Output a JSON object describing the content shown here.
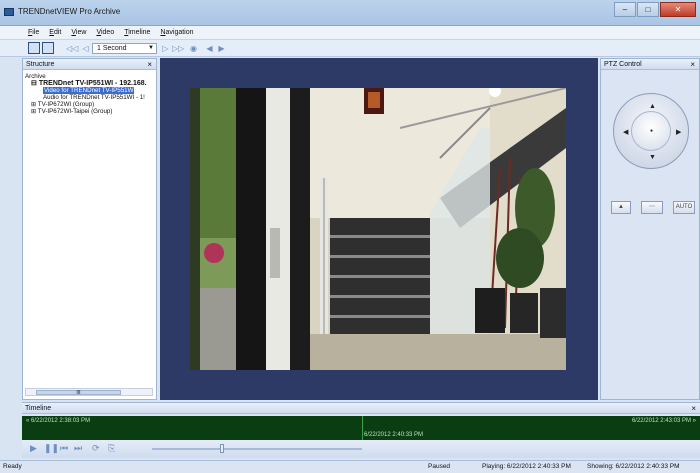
{
  "window": {
    "title": "TRENDnetVIEW Pro Archive"
  },
  "menu": [
    "File",
    "Edit",
    "View",
    "Video",
    "Timeline",
    "Navigation"
  ],
  "toolbar": {
    "speed": "1 Second"
  },
  "structure": {
    "title": "Structure",
    "root": "Archive",
    "device": "TRENDnet TV-IP551WI - 192.168.",
    "video_item": "Video for TRENDnet TV-IP551W",
    "audio_item": "Audio for TRENDnet TV-IP551WI - 1!",
    "group1": "TV-IP672WI (Group)",
    "group2": "TV-IP672WI-Taipei (Group)",
    "scroll_thumb": "III"
  },
  "ptz": {
    "title": "PTZ Control",
    "btn_auto": "AUTO"
  },
  "timeline": {
    "title": "Timeline",
    "start": "6/22/2012 2:38:03 PM",
    "current": "6/22/2012 2:40:33 PM",
    "end": "6/22/2012 2:43:03 PM"
  },
  "status": {
    "ready": "Ready",
    "state": "Paused",
    "playing": "Playing: 6/22/2012 2:40:33 PM",
    "showing": "Showing: 6/22/2012 2:40:33 PM"
  },
  "colors": {
    "video_bg": "#2e3a66",
    "timeline_bg": "#0a3d11",
    "selection": "#3b6bd4"
  }
}
